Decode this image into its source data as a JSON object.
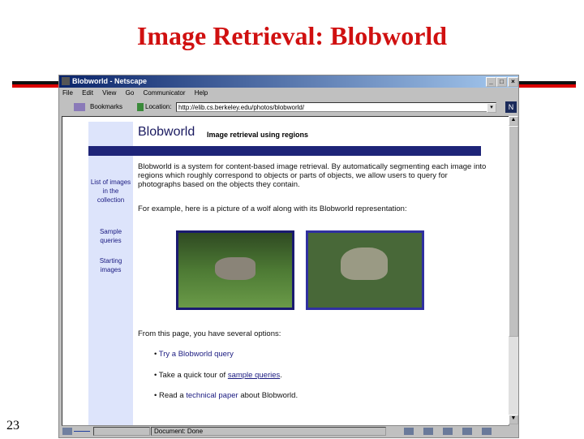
{
  "slide": {
    "title": "Image Retrieval: Blobworld",
    "number": "23"
  },
  "window": {
    "title": "Blobworld - Netscape",
    "min": "_",
    "max": "□",
    "close": "×"
  },
  "menu": [
    "File",
    "Edit",
    "View",
    "Go",
    "Communicator",
    "Help"
  ],
  "toolbar": {
    "bookmarks": "Bookmarks",
    "location_label": "Location:",
    "url": "http://elib.cs.berkeley.edu/photos/blobworld/"
  },
  "page": {
    "logo": "Blobworld",
    "subtitle": "Image retrieval using regions",
    "sidebar": [
      "List of images in the collection",
      "Sample queries",
      "Starting images"
    ],
    "intro": "Blobworld is a system for content-based image retrieval. By automatically segmenting each image into regions which roughly correspond to objects or parts of objects, we allow users to query for photographs based on the objects they contain.",
    "example": "For example, here is a picture of a wolf along with its Blobworld representation:",
    "options_intro": "From this page, you have several options:",
    "opt1": "Try a Blobworld query",
    "opt2_pre": "Take a quick tour of ",
    "opt2_link": "sample queries",
    "opt2_post": ".",
    "opt3_pre": "Read a ",
    "opt3_link": "technical paper",
    "opt3_post": " about Blobworld."
  },
  "status": {
    "text": "Document: Done"
  }
}
